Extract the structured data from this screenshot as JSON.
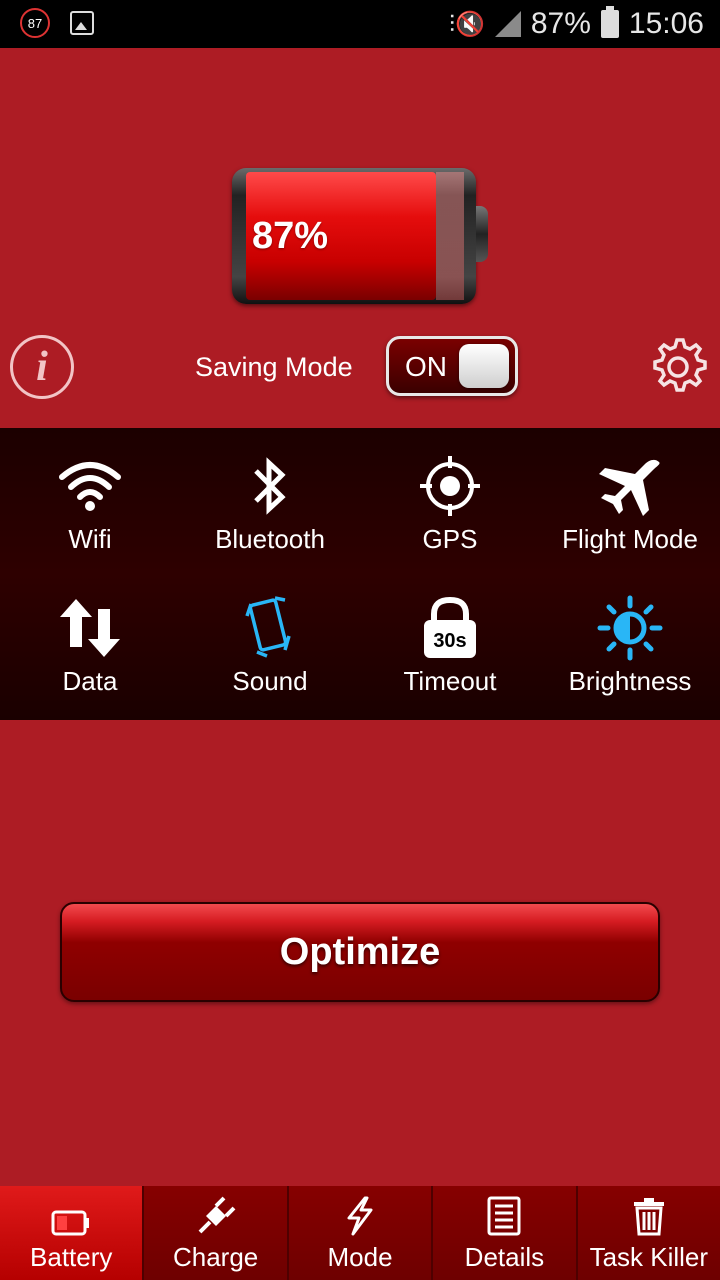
{
  "status_bar": {
    "notification_badge": "87",
    "battery_percent": "87%",
    "time": "15:06"
  },
  "battery": {
    "level": 0.87,
    "label": "87%"
  },
  "saving_mode": {
    "label": "Saving Mode",
    "toggle_state": "ON"
  },
  "quick_toggles": [
    {
      "label": "Wifi",
      "icon": "wifi-icon"
    },
    {
      "label": "Bluetooth",
      "icon": "bluetooth-icon"
    },
    {
      "label": "GPS",
      "icon": "gps-icon"
    },
    {
      "label": "Flight Mode",
      "icon": "airplane-icon"
    },
    {
      "label": "Data",
      "icon": "data-arrows-icon"
    },
    {
      "label": "Sound",
      "icon": "vibrate-icon"
    },
    {
      "label": "Timeout",
      "icon": "timeout-lock-icon",
      "badge": "30s"
    },
    {
      "label": "Brightness",
      "icon": "brightness-icon"
    }
  ],
  "optimize_button": "Optimize",
  "bottom_nav": [
    {
      "label": "Battery",
      "icon": "battery-icon",
      "active": true
    },
    {
      "label": "Charge",
      "icon": "plug-icon",
      "active": false
    },
    {
      "label": "Mode",
      "icon": "lightning-icon",
      "active": false
    },
    {
      "label": "Details",
      "icon": "document-icon",
      "active": false
    },
    {
      "label": "Task Killer",
      "icon": "trash-icon",
      "active": false
    }
  ],
  "colors": {
    "background": "#ad1c24",
    "panel": "#1c0000",
    "accent_blue": "#29b6f6"
  }
}
